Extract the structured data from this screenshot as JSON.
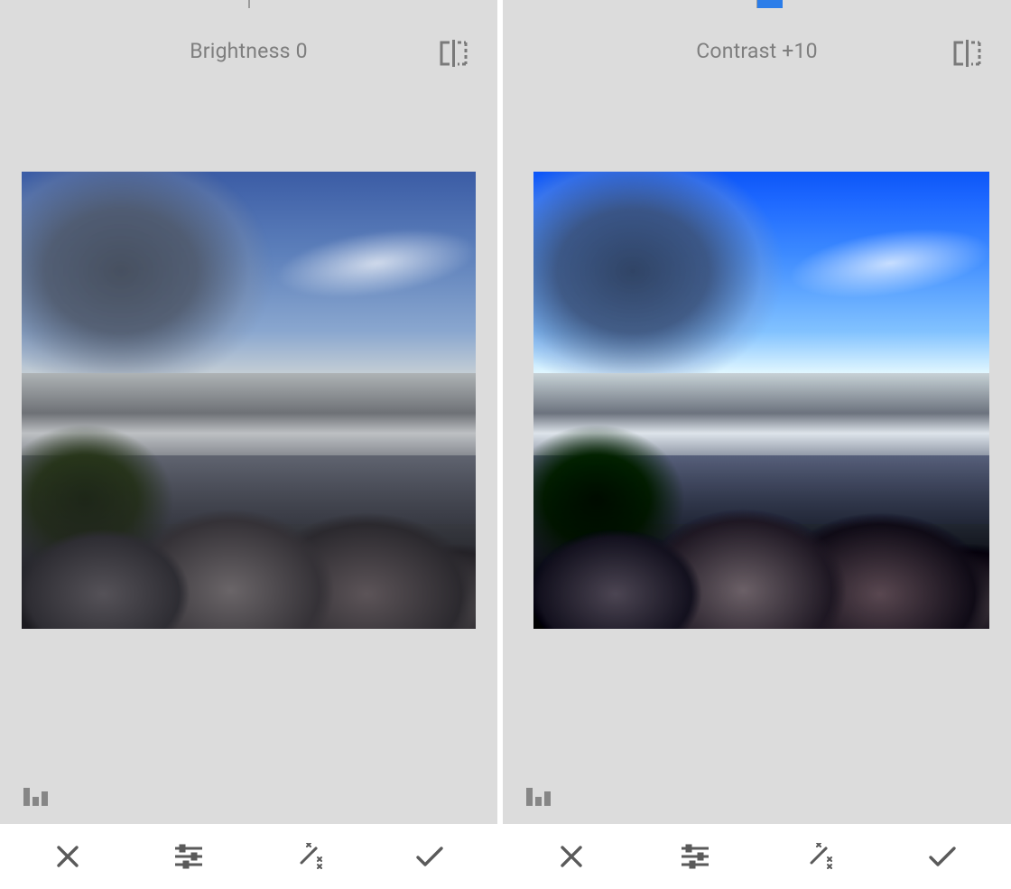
{
  "panes": [
    {
      "adjustment_label": "Brightness 0",
      "slider": {
        "value": 0,
        "fill_left_pct": 50,
        "fill_width_pct": 0
      }
    },
    {
      "adjustment_label": "Contrast +10",
      "slider": {
        "value": 10,
        "fill_left_pct": 50,
        "fill_width_pct": 5
      }
    }
  ],
  "icons": {
    "compare": "compare",
    "histogram": "histogram",
    "cancel": "cancel",
    "tune": "tune",
    "auto": "auto-fix",
    "apply": "apply"
  }
}
